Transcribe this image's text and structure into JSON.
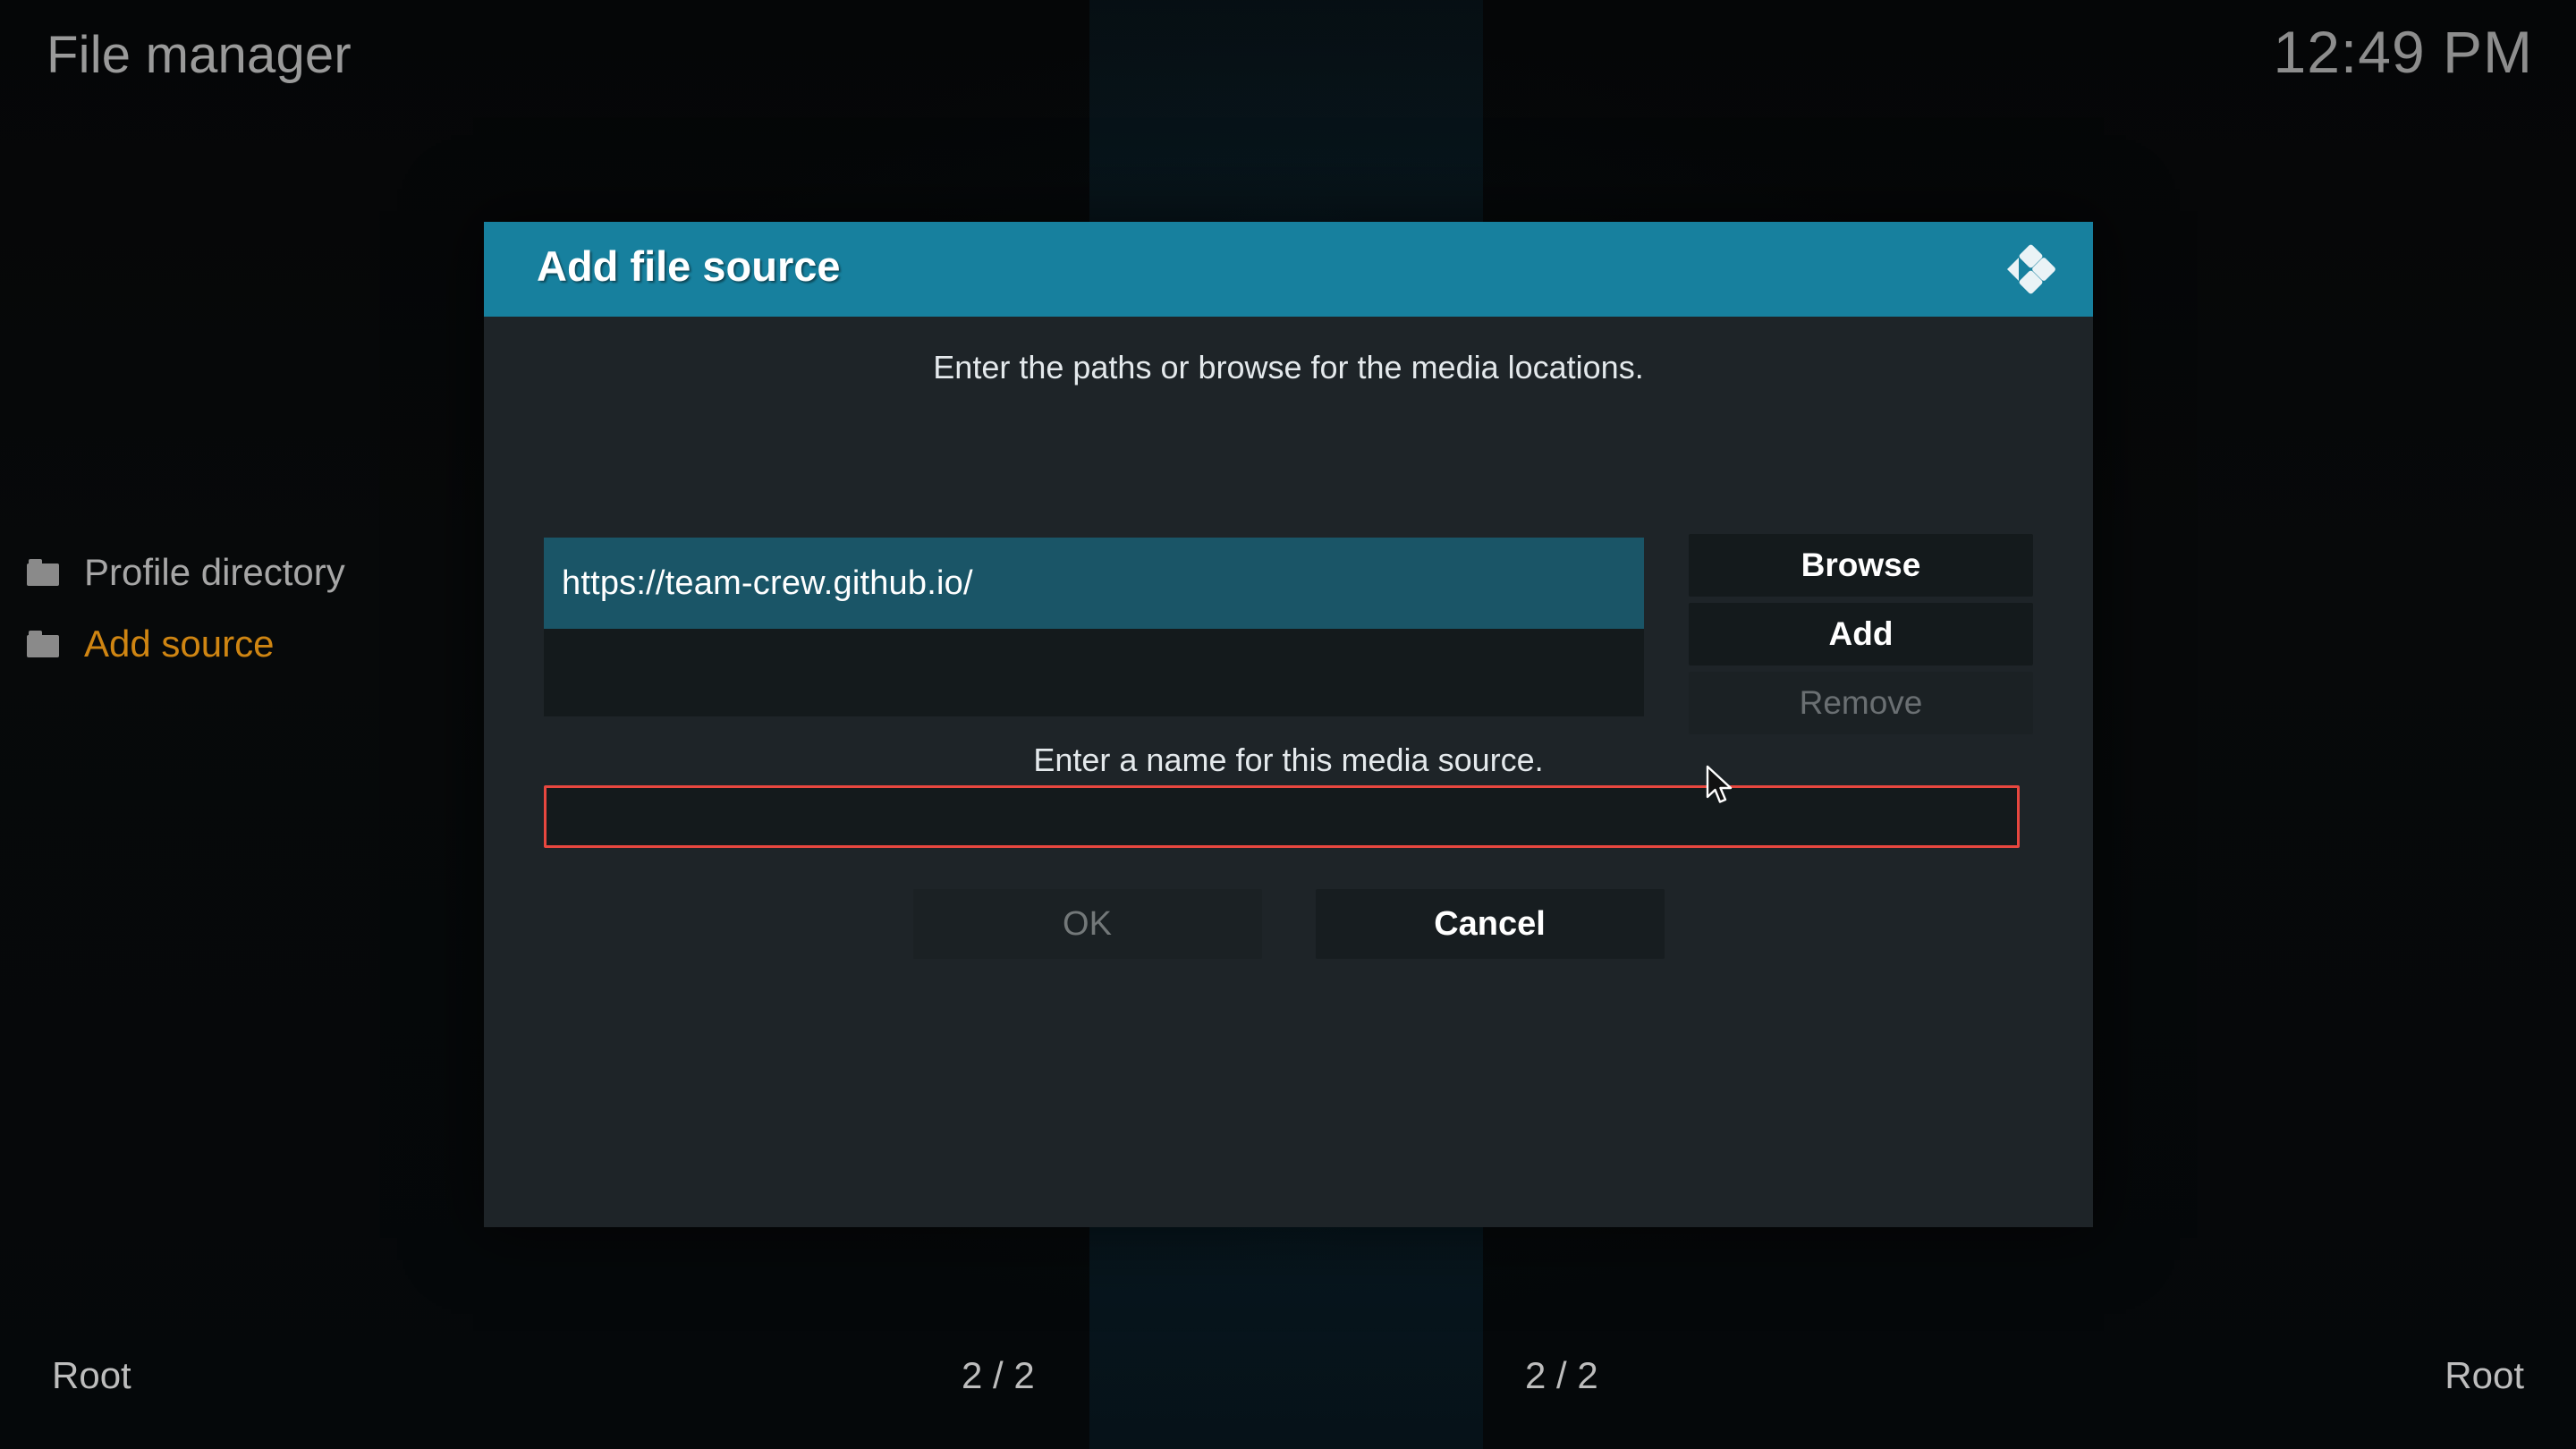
{
  "header": {
    "title": "File manager",
    "clock": "12:49 PM"
  },
  "sidebar": {
    "items": [
      {
        "label": "Profile directory",
        "icon": "folder-icon",
        "selected": false
      },
      {
        "label": "Add source",
        "icon": "folder-icon",
        "selected": true
      }
    ]
  },
  "dialog": {
    "title": "Add file source",
    "logo_icon": "kodi-logo-icon",
    "paths_hint": "Enter the paths or browse for the media locations.",
    "path_list": [
      {
        "value": "https://team-crew.github.io/",
        "selected": true
      }
    ],
    "side_buttons": [
      {
        "label": "Browse",
        "enabled": true
      },
      {
        "label": "Add",
        "enabled": true
      },
      {
        "label": "Remove",
        "enabled": false
      }
    ],
    "name_hint": "Enter a name for this media source.",
    "name_input": {
      "value": "",
      "placeholder": "",
      "invalid": true,
      "border_color": "#e8473f"
    },
    "footer_buttons": [
      {
        "label": "OK",
        "enabled": false
      },
      {
        "label": "Cancel",
        "enabled": true
      }
    ]
  },
  "statusbar": {
    "left_path": "Root",
    "left_count": "2 / 2",
    "right_count": "2 / 2",
    "right_path": "Root"
  },
  "colors": {
    "accent": "#17809e",
    "selection": "#1a5567",
    "highlight_text": "#cf8512",
    "error_border": "#e8473f",
    "dialog_bg": "#1e2428",
    "panel_bg": "#141a1c"
  }
}
